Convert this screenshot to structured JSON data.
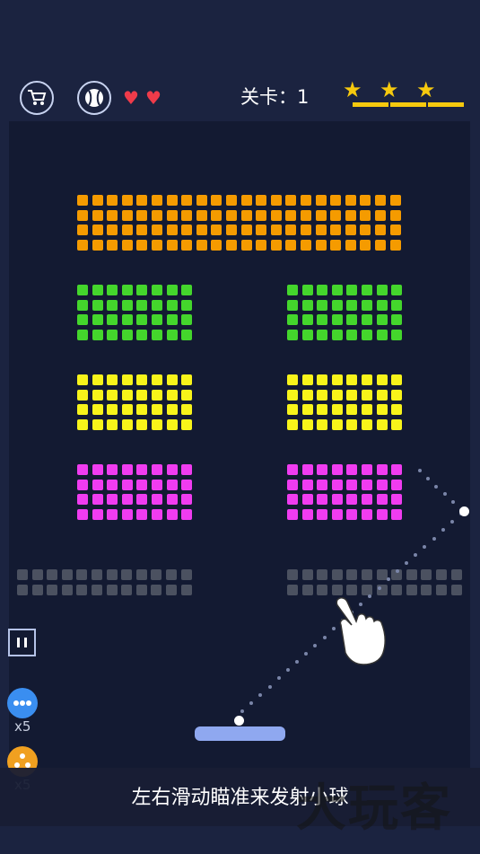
{
  "hud": {
    "shop_icon": "cart-icon",
    "ball_icon": "baseball-icon",
    "lives": 2,
    "level_text": "关卡：1",
    "stars_earned": 3
  },
  "bricks": {
    "colors": {
      "orange": "#f59b00",
      "green": "#44d62c",
      "yellow": "#f8f41a",
      "magenta": "#f03cf0",
      "gray": "#4b5160"
    },
    "groups": [
      {
        "name": "orange-block",
        "color": "orange",
        "cols": 22,
        "rows": 4
      },
      {
        "name": "green-block-left",
        "color": "green",
        "cols": 8,
        "rows": 4
      },
      {
        "name": "green-block-right",
        "color": "green",
        "cols": 8,
        "rows": 4
      },
      {
        "name": "yellow-block-left",
        "color": "yellow",
        "cols": 8,
        "rows": 4
      },
      {
        "name": "yellow-block-right",
        "color": "yellow",
        "cols": 8,
        "rows": 4
      },
      {
        "name": "magenta-block-left",
        "color": "magenta",
        "cols": 8,
        "rows": 4
      },
      {
        "name": "magenta-block-right",
        "color": "magenta",
        "cols": 8,
        "rows": 4
      },
      {
        "name": "gray-row-left",
        "color": "gray",
        "cols": 12,
        "rows": 2
      },
      {
        "name": "gray-row-right",
        "color": "gray",
        "cols": 12,
        "rows": 2
      }
    ]
  },
  "controls": {
    "pause_icon": "pause-icon",
    "powerups": [
      {
        "icon": "multi-ball-icon",
        "color": "#3a8ef0",
        "count": "x5"
      },
      {
        "icon": "split-ball-icon",
        "color": "#f0a020",
        "count": "x5"
      }
    ]
  },
  "hint": "左右滑动瞄准来发射小球",
  "watermark": "大玩客"
}
